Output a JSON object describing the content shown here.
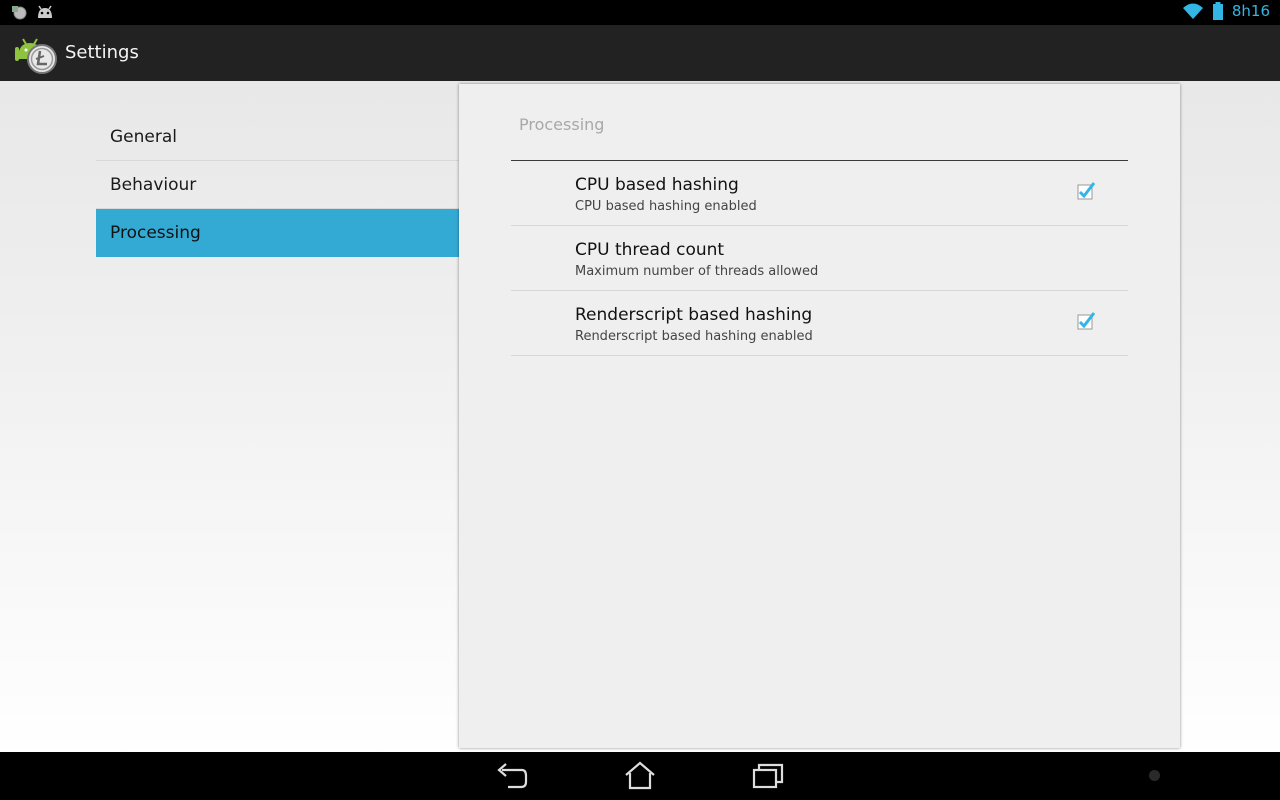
{
  "status_bar": {
    "clock": "8h16",
    "icons": [
      "notification-litecoin-icon",
      "notification-android-icon",
      "wifi-icon",
      "battery-icon"
    ]
  },
  "action_bar": {
    "title": "Settings",
    "app_icon": "app-litecoin-android-icon"
  },
  "headers": [
    {
      "label": "General"
    },
    {
      "label": "Behaviour"
    },
    {
      "label": "Processing"
    }
  ],
  "panel": {
    "category": "Processing",
    "prefs": [
      {
        "title": "CPU based hashing",
        "summary": "CPU based hashing enabled",
        "checked": true
      },
      {
        "title": "CPU thread count",
        "summary": "Maximum number of threads allowed"
      },
      {
        "title": "Renderscript based hashing",
        "summary": "Renderscript based hashing enabled",
        "checked": true
      }
    ]
  },
  "nav_bar": {
    "icons": [
      "back-icon",
      "home-icon",
      "recent-apps-icon"
    ]
  },
  "colors": {
    "accent": "#33b5e5",
    "selected_header": "#33aad4",
    "action_bar": "#222222"
  }
}
